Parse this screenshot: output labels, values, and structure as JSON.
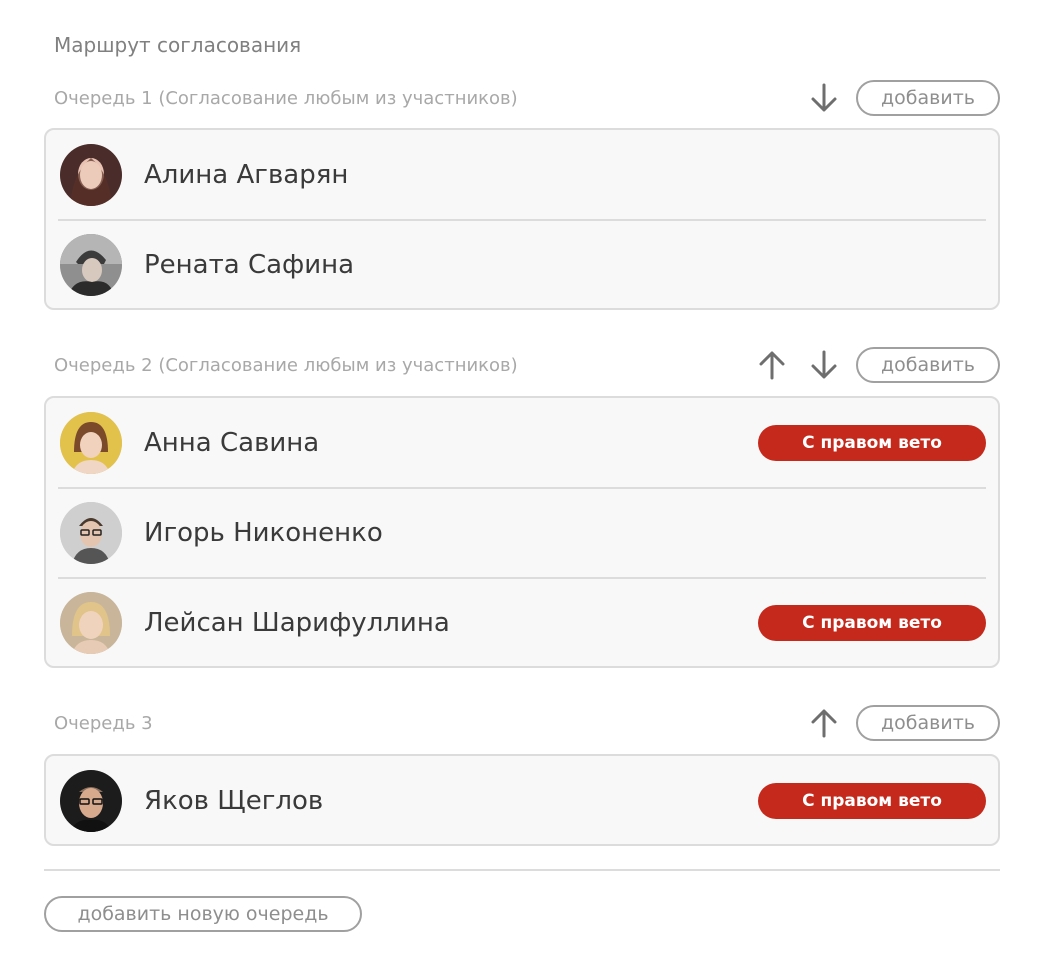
{
  "title": "Маршрут согласования",
  "add_label": "добавить",
  "veto_label": "С правом вето",
  "add_queue_label": "добавить новую очередь",
  "colors": {
    "veto": "#c4291c",
    "border": "#dcdcdc",
    "muted": "#a8a8a8"
  },
  "icons": {
    "up": "arrow-up-icon",
    "down": "arrow-down-icon"
  },
  "queues": [
    {
      "label": "Очередь 1 (Согласование любым из участников)",
      "up": false,
      "down": true,
      "members": [
        {
          "name": "Алина Агварян",
          "veto": false
        },
        {
          "name": "Рената Сафина",
          "veto": false
        }
      ]
    },
    {
      "label": "Очередь 2 (Согласование любым из участников)",
      "up": true,
      "down": true,
      "members": [
        {
          "name": "Анна Савина",
          "veto": true
        },
        {
          "name": "Игорь Никоненко",
          "veto": false
        },
        {
          "name": "Лейсан Шарифуллина",
          "veto": true
        }
      ]
    },
    {
      "label": "Очередь 3",
      "up": true,
      "down": false,
      "members": [
        {
          "name": "Яков Щеглов",
          "veto": true
        }
      ]
    }
  ]
}
